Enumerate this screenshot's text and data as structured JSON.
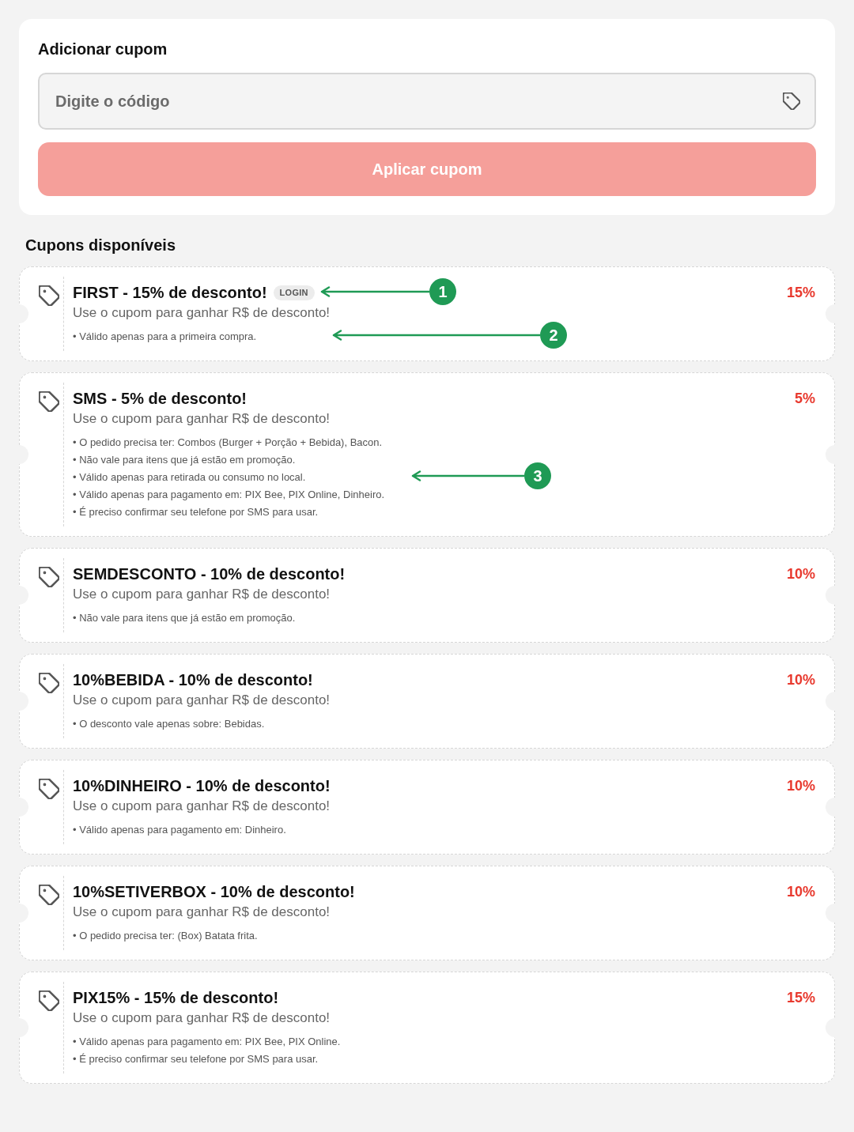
{
  "add_coupon": {
    "title": "Adicionar cupom",
    "code_field": {
      "placeholder": "Digite o código"
    },
    "apply_button": {
      "label": "Aplicar cupom",
      "disabled": true
    }
  },
  "available": {
    "title": "Cupons disponíveis",
    "coupons": [
      {
        "title": "FIRST - 15% de desconto!",
        "badge": "LOGIN",
        "description": "Use o cupom para ganhar R$ de desconto!",
        "conditions": [
          "• Válido apenas para a primeira compra."
        ],
        "discount": "15%"
      },
      {
        "title": "SMS - 5% de desconto!",
        "description": "Use o cupom para ganhar R$ de desconto!",
        "conditions": [
          "• O pedido precisa ter: Combos (Burger + Porção + Bebida), Bacon.",
          "• Não vale para itens que já estão em promoção.",
          "• Válido apenas para retirada ou consumo no local.",
          "• Válido apenas para pagamento em: PIX Bee, PIX Online, Dinheiro.",
          "• É preciso confirmar seu telefone por SMS para usar."
        ],
        "discount": "5%"
      },
      {
        "title": "SEMDESCONTO - 10% de desconto!",
        "description": "Use o cupom para ganhar R$ de desconto!",
        "conditions": [
          "• Não vale para itens que já estão em promoção."
        ],
        "discount": "10%"
      },
      {
        "title": "10%BEBIDA - 10% de desconto!",
        "description": "Use o cupom para ganhar R$ de desconto!",
        "conditions": [
          "• O desconto vale apenas sobre: Bebidas."
        ],
        "discount": "10%"
      },
      {
        "title": "10%DINHEIRO - 10% de desconto!",
        "description": "Use o cupom para ganhar R$ de desconto!",
        "conditions": [
          "• Válido apenas para pagamento em: Dinheiro."
        ],
        "discount": "10%"
      },
      {
        "title": "10%SETIVERBOX - 10% de desconto!",
        "description": "Use o cupom para ganhar R$ de desconto!",
        "conditions": [
          "• O pedido precisa ter: (Box) Batata frita."
        ],
        "discount": "10%"
      },
      {
        "title": "PIX15% - 15% de desconto!",
        "description": "Use o cupom para ganhar R$ de desconto!",
        "conditions": [
          "• Válido apenas para pagamento em: PIX Bee, PIX Online.",
          "• É preciso confirmar seu telefone por SMS para usar."
        ],
        "discount": "15%"
      }
    ]
  },
  "callouts": [
    {
      "number": "1"
    },
    {
      "number": "2"
    },
    {
      "number": "3"
    }
  ]
}
